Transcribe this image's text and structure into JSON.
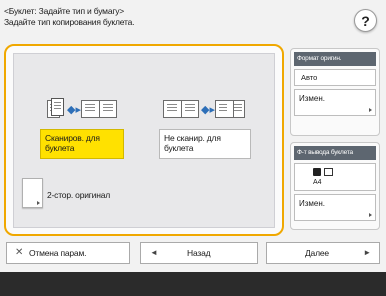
{
  "header": {
    "title_line1": "<Буклет: Задайте тип и бумагу>",
    "title_line2": "Задайте тип копирования буклета.",
    "help_label": "?"
  },
  "options": {
    "scan_for_booklet": "Сканиров. для\nбуклета",
    "no_scan_for_booklet": "Не сканир. для\nбуклета",
    "double_sided_original": "2-стор. оригинал"
  },
  "side_panel": {
    "original_format": {
      "heading": "Формат оригин.",
      "value": "Авто",
      "change_label": "Измен."
    },
    "booklet_output": {
      "heading": "Ф-т вывода буклета",
      "size": "А4",
      "change_label": "Измен."
    }
  },
  "footer": {
    "cancel_label": "Отмена парам.",
    "back_label": "Назад",
    "next_label": "Далее"
  }
}
